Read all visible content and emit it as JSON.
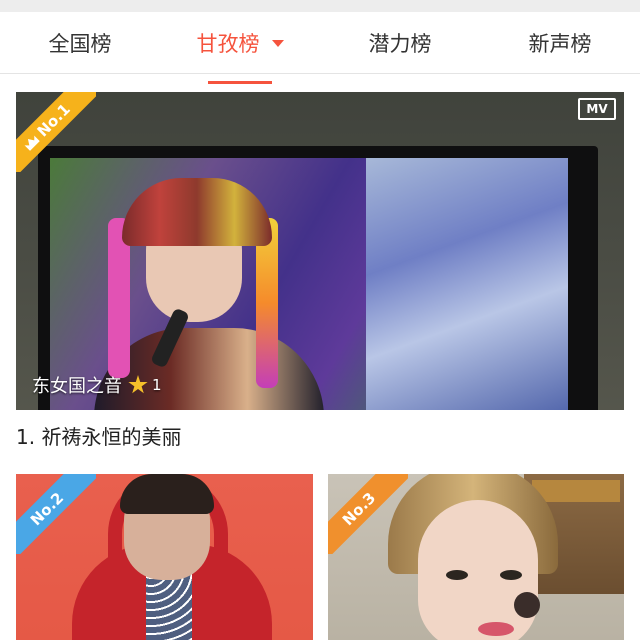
{
  "tabs": [
    {
      "label": "全国榜",
      "active": false
    },
    {
      "label": "甘孜榜",
      "active": true,
      "has_dropdown": true
    },
    {
      "label": "潜力榜",
      "active": false
    },
    {
      "label": "新声榜",
      "active": false
    }
  ],
  "colors": {
    "accent": "#f5533d",
    "gold": "#f6b21b",
    "blue": "#4aa7e6",
    "orange": "#f0902d"
  },
  "cards": [
    {
      "rank_badge": "No.1",
      "rank_icon": "crown-icon",
      "media_type_label": "MV",
      "overlay_title": "东女国之音",
      "star_icon": "star-icon",
      "star_count": "1",
      "song_title": "1. 祈祷永恒的美丽"
    },
    {
      "rank_badge": "No.2"
    },
    {
      "rank_badge": "No.3"
    }
  ]
}
